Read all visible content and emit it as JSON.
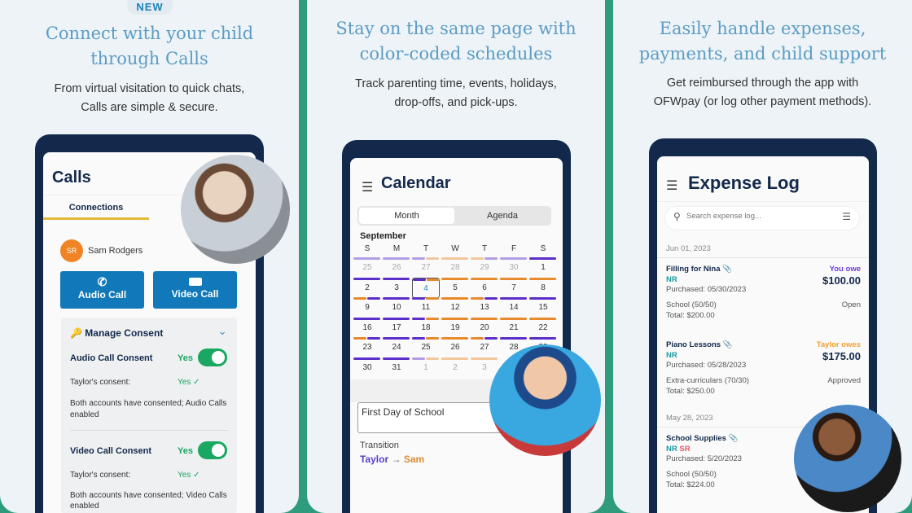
{
  "colors": {
    "background": "#2e9c7c",
    "frame": "#13294b",
    "accent_blue": "#1179b9",
    "purple": "#5b2fc9",
    "orange": "#e8892b",
    "teal": "#1b9aa0",
    "toggle_green": "#1aa761"
  },
  "panel1": {
    "badge": "NEW",
    "headline_1": "Connect with your child",
    "headline_2": "through Calls",
    "sub_1": "From virtual visitation to quick chats,",
    "sub_2": "Calls are simple & secure.",
    "app": {
      "title": "Calls",
      "tab": "Connections",
      "contact_initials": "SR",
      "contact_name": "Sam Rodgers",
      "audio_button": "Audio Call",
      "video_button": "Video Call",
      "icon_audio": "phone-icon",
      "icon_video": "video-camera-icon",
      "consent_title": "Manage Consent",
      "audio_consent": "Audio Call Consent",
      "video_consent": "Video Call Consent",
      "yes": "Yes",
      "taylor_consent": "Taylor's consent:",
      "audio_msg": "Both accounts have consented; Audio Calls enabled",
      "video_msg": "Both accounts have consented; Video Calls enabled",
      "audio_toggle_on": true,
      "video_toggle_on": true
    }
  },
  "panel2": {
    "headline_1": "Stay on the same page with",
    "headline_2": "color-coded schedules",
    "sub_1": "Track parenting time, events, holidays,",
    "sub_2": "drop-offs, and pick-ups.",
    "app": {
      "title": "Calendar",
      "tabs": [
        "Month",
        "Agenda"
      ],
      "active_tab": "Month",
      "month": "September",
      "weekdays": [
        "S",
        "M",
        "T",
        "W",
        "T",
        "F",
        "S"
      ],
      "days": [
        [
          "25",
          "p",
          0
        ],
        [
          "26",
          "p",
          0
        ],
        [
          "27",
          "po",
          0
        ],
        [
          "28",
          "o",
          0
        ],
        [
          "29",
          "op",
          0
        ],
        [
          "30",
          "p",
          0
        ],
        [
          "1",
          "p",
          1
        ],
        [
          "2",
          "p",
          1
        ],
        [
          "3",
          "p",
          1
        ],
        [
          "4",
          "po",
          1
        ],
        [
          "5",
          "o",
          1
        ],
        [
          "6",
          "o",
          1
        ],
        [
          "7",
          "o",
          1
        ],
        [
          "8",
          "o",
          1
        ],
        [
          "9",
          "op",
          1
        ],
        [
          "10",
          "p",
          1
        ],
        [
          "11",
          "po",
          1
        ],
        [
          "12",
          "o",
          1
        ],
        [
          "13",
          "op",
          1
        ],
        [
          "14",
          "p",
          1
        ],
        [
          "15",
          "p",
          1
        ],
        [
          "16",
          "p",
          1
        ],
        [
          "17",
          "p",
          1
        ],
        [
          "18",
          "po",
          1
        ],
        [
          "19",
          "o",
          1
        ],
        [
          "20",
          "o",
          1
        ],
        [
          "21",
          "o",
          1
        ],
        [
          "22",
          "o",
          1
        ],
        [
          "23",
          "op",
          1
        ],
        [
          "24",
          "p",
          1
        ],
        [
          "25",
          "po",
          1
        ],
        [
          "26",
          "o",
          1
        ],
        [
          "27",
          "op",
          1
        ],
        [
          "28",
          "p",
          1
        ],
        [
          "29",
          "p",
          1
        ],
        [
          "30",
          "p",
          1
        ],
        [
          "31",
          "p",
          1
        ],
        [
          "1",
          "po",
          0
        ],
        [
          "2",
          "o",
          0
        ],
        [
          "3",
          "o",
          0
        ]
      ],
      "selected_day": "4",
      "event": "First Day of School",
      "transition_label": "Transition",
      "from": "Taylor",
      "to": "Sam"
    }
  },
  "panel3": {
    "headline_1": "Easily handle expenses,",
    "headline_2": "payments, and child support",
    "sub_1": "Get reimbursed through the app with",
    "sub_2": "OFWpay (or log other payment methods).",
    "app": {
      "title": "Expense Log",
      "search_placeholder": "Search expense log...",
      "groups": [
        {
          "date": "Jun 01, 2023",
          "items": [
            {
              "name": "Filling for Nina",
              "tags": [
                "NR"
              ],
              "purchased": "Purchased: 05/30/2023",
              "category": "School (50/50)",
              "total": "Total: $200.00",
              "owe": "You owe",
              "owe_color": "#6a3fd4",
              "amount": "$100.00",
              "status": "Open"
            },
            {
              "name": "Piano Lessons",
              "tags": [
                "NR"
              ],
              "purchased": "Purchased: 05/28/2023",
              "category": "Extra-curriculars (70/30)",
              "total": "Total: $250.00",
              "owe": "Taylor owes",
              "owe_color": "#f0a030",
              "amount": "$175.00",
              "status": "Approved"
            }
          ]
        },
        {
          "date": "May 28, 2023",
          "items": [
            {
              "name": "School Supplies",
              "tags": [
                "NR",
                "SR"
              ],
              "purchased": "Purchased: 5/20/2023",
              "category": "School (50/50)",
              "total": "Total: $224.00"
            }
          ]
        }
      ]
    }
  }
}
